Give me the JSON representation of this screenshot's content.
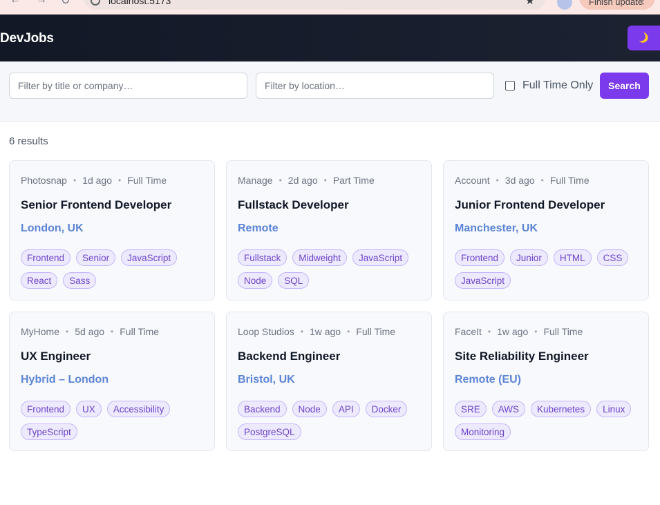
{
  "browser": {
    "url": "localhost:5173",
    "update_label": "Finish update",
    "back_glyph": "←",
    "forward_glyph": "→",
    "reload_glyph": "↻",
    "star_glyph": "★",
    "menu_glyph": "⋮"
  },
  "header": {
    "logo": "DevJobs",
    "theme_toggle_icon": "🌙"
  },
  "filters": {
    "title_placeholder": "Filter by title or company…",
    "location_placeholder": "Filter by location…",
    "fulltime_label": "Full Time Only",
    "search_label": "Search"
  },
  "results": {
    "count_text": "6 results"
  },
  "jobs": [
    {
      "company": "Photosnap",
      "posted": "1d ago",
      "contract": "Full Time",
      "title": "Senior Frontend Developer",
      "location": "London, UK",
      "tags": [
        "Frontend",
        "Senior",
        "JavaScript",
        "React",
        "Sass"
      ]
    },
    {
      "company": "Manage",
      "posted": "2d ago",
      "contract": "Part Time",
      "title": "Fullstack Developer",
      "location": "Remote",
      "tags": [
        "Fullstack",
        "Midweight",
        "JavaScript",
        "Node",
        "SQL"
      ]
    },
    {
      "company": "Account",
      "posted": "3d ago",
      "contract": "Full Time",
      "title": "Junior Frontend Developer",
      "location": "Manchester, UK",
      "tags": [
        "Frontend",
        "Junior",
        "HTML",
        "CSS",
        "JavaScript"
      ]
    },
    {
      "company": "MyHome",
      "posted": "5d ago",
      "contract": "Full Time",
      "title": "UX Engineer",
      "location": "Hybrid – London",
      "tags": [
        "Frontend",
        "UX",
        "Accessibility",
        "TypeScript"
      ]
    },
    {
      "company": "Loop Studios",
      "posted": "1w ago",
      "contract": "Full Time",
      "title": "Backend Engineer",
      "location": "Bristol, UK",
      "tags": [
        "Backend",
        "Node",
        "API",
        "Docker",
        "PostgreSQL"
      ]
    },
    {
      "company": "FaceIt",
      "posted": "1w ago",
      "contract": "Full Time",
      "title": "Site Reliability Engineer",
      "location": "Remote (EU)",
      "tags": [
        "SRE",
        "AWS",
        "Kubernetes",
        "Linux",
        "Monitoring"
      ]
    }
  ],
  "colors": {
    "accent": "#7c3aed",
    "header_bg": "#161c2a",
    "location": "#5b84d6",
    "tag_bg": "#ede9fe"
  }
}
